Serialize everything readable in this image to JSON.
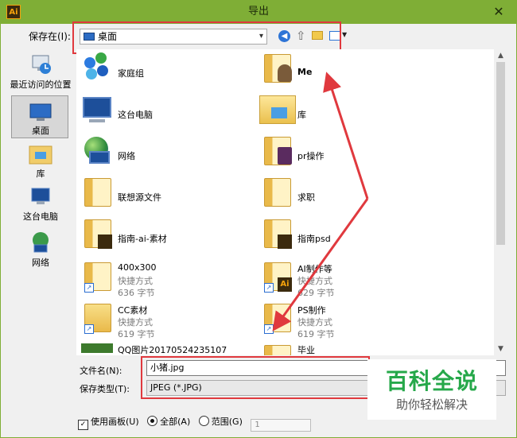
{
  "window": {
    "app_icon_text": "Ai",
    "title": "导出",
    "close_glyph": "✕"
  },
  "toolbar": {
    "save_in_label": "保存在(I):",
    "save_in_value": "桌面",
    "back_icon": "back-arrow-icon",
    "up_icon": "up-folder-icon",
    "new_folder_icon": "new-folder-icon",
    "view_menu_icon": "view-menu-icon"
  },
  "places": [
    {
      "label": "最近访问的位置",
      "icon": "recent-places-icon"
    },
    {
      "label": "桌面",
      "icon": "desktop-icon"
    },
    {
      "label": "库",
      "icon": "library-icon"
    },
    {
      "label": "这台电脑",
      "icon": "computer-icon"
    },
    {
      "label": "网络",
      "icon": "network-icon"
    }
  ],
  "files": [
    {
      "name": "家庭组",
      "icon": "homegroup-icon"
    },
    {
      "name": "Me",
      "icon": "user-folder-icon"
    },
    {
      "name": "这台电脑",
      "icon": "computer-icon"
    },
    {
      "name": "库",
      "icon": "library-icon"
    },
    {
      "name": "网络",
      "icon": "network-icon"
    },
    {
      "name": "pr操作",
      "icon": "folder-icon"
    },
    {
      "name": "联想源文件",
      "icon": "folder-icon"
    },
    {
      "name": "求职",
      "icon": "folder-icon"
    },
    {
      "name": "指南-ai-素材",
      "icon": "folder-icon"
    },
    {
      "name": "指南psd",
      "icon": "folder-icon"
    },
    {
      "name": "400x300",
      "type": "快捷方式",
      "size": "636 字节",
      "icon": "folder-shortcut-icon"
    },
    {
      "name": "AI制作等",
      "type": "快捷方式",
      "size": "629 字节",
      "icon": "ai-shortcut-icon"
    },
    {
      "name": "CC素材",
      "type": "快捷方式",
      "size": "619 字节",
      "icon": "folder-shortcut-icon"
    },
    {
      "name": "PS制作",
      "type": "快捷方式",
      "size": "619 字节",
      "icon": "folder-shortcut-icon"
    },
    {
      "name": "QQ图片20170524235107",
      "icon": "image-file-icon"
    },
    {
      "name": "毕业",
      "icon": "folder-icon"
    }
  ],
  "form": {
    "filename_label": "文件名(N):",
    "filename_value": "小猪.jpg",
    "filetype_label": "保存类型(T):",
    "filetype_value": "JPEG (*.JPG)"
  },
  "options": {
    "use_artboards_label": "使用画板(U)",
    "use_artboards_checked": true,
    "all_label": "全部(A)",
    "range_label": "范围(G)",
    "range_value": "1",
    "selected_radio": "all"
  },
  "watermark": {
    "top": "百科全说",
    "bottom": "助你轻松解决"
  },
  "colors": {
    "title_bar": "#7fae36",
    "annotation_red": "#e0393e",
    "watermark_green": "#26a84a"
  }
}
